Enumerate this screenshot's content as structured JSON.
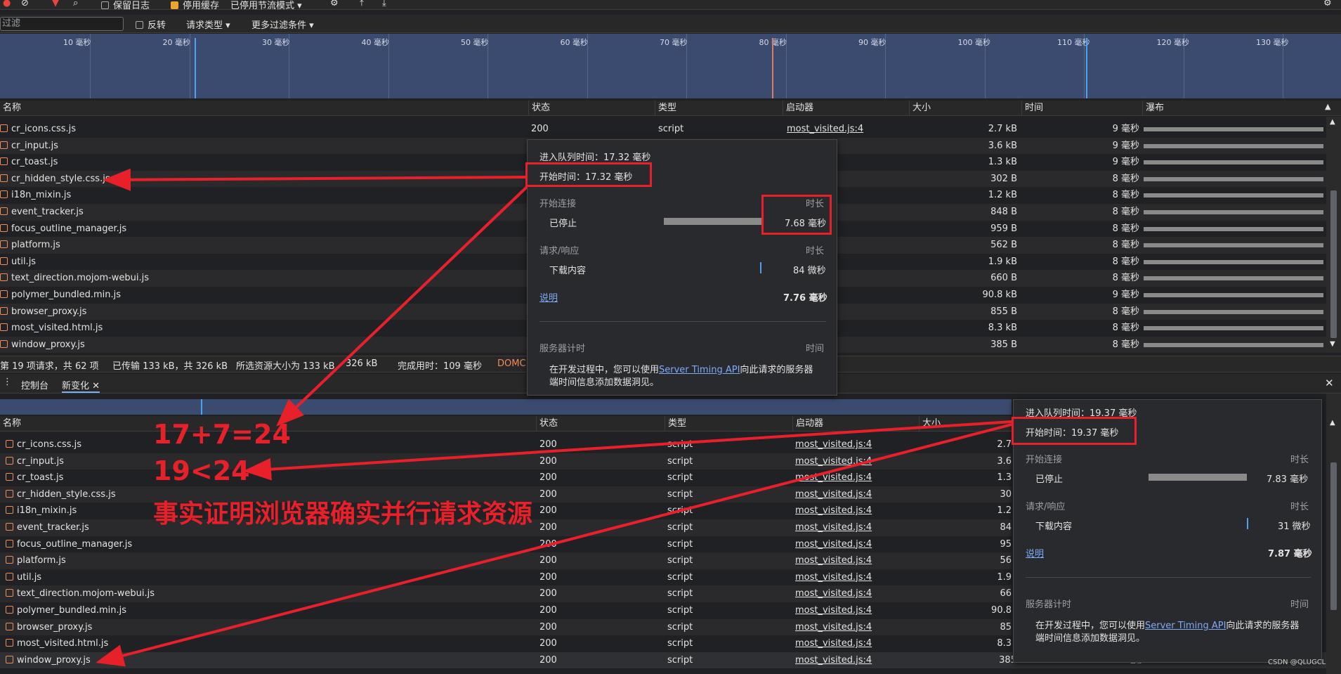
{
  "toolbar": {
    "preserve_log": "保留日志",
    "disable_cache": "停用缓存",
    "throttle": "已停用节流模式"
  },
  "filterbar": {
    "filter_placeholder": "过滤",
    "invert": "反转",
    "request_type": "请求类型",
    "more_filters": "更多过滤条件"
  },
  "overview": {
    "ticks": [
      "10 毫秒",
      "20 毫秒",
      "30 毫秒",
      "40 毫秒",
      "50 毫秒",
      "60 毫秒",
      "70 毫秒",
      "80 毫秒",
      "90 毫秒",
      "100 毫秒",
      "110 毫秒",
      "120 毫秒",
      "130 毫秒"
    ]
  },
  "columns": {
    "name": "名称",
    "status": "状态",
    "type": "类型",
    "initiator": "启动器",
    "size": "大小",
    "time": "时间",
    "waterfall": "瀑布"
  },
  "table_top": {
    "rows": [
      {
        "name": "cr_icons.css.js",
        "status": "200",
        "type": "script",
        "initiator": "most_visited.js:4",
        "size": "2.7 kB",
        "time": "9 毫秒"
      },
      {
        "name": "cr_input.js",
        "status": "",
        "type": "",
        "initiator": "js:4",
        "size": "3.6 kB",
        "time": "9 毫秒"
      },
      {
        "name": "cr_toast.js",
        "status": "",
        "type": "",
        "initiator": "js:4",
        "size": "1.3 kB",
        "time": "9 毫秒"
      },
      {
        "name": "cr_hidden_style.css.js",
        "status": "",
        "type": "",
        "initiator": "js:4",
        "size": "302 B",
        "time": "8 毫秒"
      },
      {
        "name": "i18n_mixin.js",
        "status": "",
        "type": "",
        "initiator": "js:4",
        "size": "1.2 kB",
        "time": "8 毫秒"
      },
      {
        "name": "event_tracker.js",
        "status": "",
        "type": "",
        "initiator": "js:4",
        "size": "848 B",
        "time": "8 毫秒"
      },
      {
        "name": "focus_outline_manager.js",
        "status": "",
        "type": "",
        "initiator": "js:4",
        "size": "959 B",
        "time": "8 毫秒"
      },
      {
        "name": "platform.js",
        "status": "",
        "type": "",
        "initiator": "js:4",
        "size": "562 B",
        "time": "8 毫秒"
      },
      {
        "name": "util.js",
        "status": "",
        "type": "",
        "initiator": "js:4",
        "size": "1.9 kB",
        "time": "8 毫秒"
      },
      {
        "name": "text_direction.mojom-webui.js",
        "status": "",
        "type": "",
        "initiator": "js:4",
        "size": "660 B",
        "time": "8 毫秒"
      },
      {
        "name": "polymer_bundled.min.js",
        "status": "",
        "type": "",
        "initiator": "js:4",
        "size": "90.8 kB",
        "time": "9 毫秒"
      },
      {
        "name": "browser_proxy.js",
        "status": "",
        "type": "",
        "initiator": "js:4",
        "size": "855 B",
        "time": "8 毫秒"
      },
      {
        "name": "most_visited.html.js",
        "status": "",
        "type": "",
        "initiator": "js:4",
        "size": "8.3 kB",
        "time": "8 毫秒"
      },
      {
        "name": "window_proxy.js",
        "status": "",
        "type": "",
        "initiator": "js:4",
        "size": "385 B",
        "time": "8 毫秒"
      }
    ]
  },
  "statusbar": {
    "requests": "第 19 项请求，共 62 项",
    "transferred": "已传输 133 kB，共 326 kB",
    "selected": "所选资源大小为 133 kB",
    "resources": "326 kB",
    "finish": "完成用时：109 毫秒",
    "domcontent": "DOMC"
  },
  "drawer": {
    "console_tab": "控制台",
    "whats_new_tab": "新变化"
  },
  "table_bottom": {
    "rows": [
      {
        "name": "cr_icons.css.js",
        "status": "200",
        "type": "script",
        "initiator": "most_visited.js:4",
        "size": "2.7"
      },
      {
        "name": "cr_input.js",
        "status": "200",
        "type": "script",
        "initiator": "most_visited.js:4",
        "size": "3.6"
      },
      {
        "name": "cr_toast.js",
        "status": "200",
        "type": "script",
        "initiator": "most_visited.js:4",
        "size": "1.3"
      },
      {
        "name": "cr_hidden_style.css.js",
        "status": "200",
        "type": "script",
        "initiator": "most_visited.js:4",
        "size": "30"
      },
      {
        "name": "i18n_mixin.js",
        "status": "200",
        "type": "script",
        "initiator": "most_visited.js:4",
        "size": "1.2"
      },
      {
        "name": "event_tracker.js",
        "status": "200",
        "type": "script",
        "initiator": "most_visited.js:4",
        "size": "84"
      },
      {
        "name": "focus_outline_manager.js",
        "status": "200",
        "type": "script",
        "initiator": "most_visited.js:4",
        "size": "95"
      },
      {
        "name": "platform.js",
        "status": "200",
        "type": "script",
        "initiator": "most_visited.js:4",
        "size": "56"
      },
      {
        "name": "util.js",
        "status": "200",
        "type": "script",
        "initiator": "most_visited.js:4",
        "size": "1.9"
      },
      {
        "name": "text_direction.mojom-webui.js",
        "status": "200",
        "type": "script",
        "initiator": "most_visited.js:4",
        "size": "66"
      },
      {
        "name": "polymer_bundled.min.js",
        "status": "200",
        "type": "script",
        "initiator": "most_visited.js:4",
        "size": "90.8"
      },
      {
        "name": "browser_proxy.js",
        "status": "200",
        "type": "script",
        "initiator": "most_visited.js:4",
        "size": "85"
      },
      {
        "name": "most_visited.html.js",
        "status": "200",
        "type": "script",
        "initiator": "most_visited.js:4",
        "size": "8.3"
      },
      {
        "name": "window_proxy.js",
        "status": "200",
        "type": "script",
        "initiator": "most_visited.js:4",
        "size": "385 B",
        "time": "8 毫秒"
      }
    ]
  },
  "popup_top": {
    "queued": "进入队列时间：17.32 毫秒",
    "started": "开始时间：17.32 毫秒",
    "conn_start": "开始连接",
    "duration_label": "时长",
    "stalled": "已停止",
    "stalled_value": "7.68 毫秒",
    "req_resp": "请求/响应",
    "download": "下载内容",
    "download_value": "84 微秒",
    "explain": "说明",
    "total": "7.76 毫秒",
    "server_timing": "服务器计时",
    "time_label": "时间",
    "note_prefix": "在开发过程中，您可以使用",
    "note_link": "Server Timing API",
    "note_suffix": "向此请求的服务器",
    "note_line2": "端时间信息添加数据洞见。"
  },
  "popup_bottom": {
    "queued": "进入队列时间：19.37 毫秒",
    "started": "开始时间：19.37 毫秒",
    "conn_start": "开始连接",
    "duration_label": "时长",
    "stalled": "已停止",
    "stalled_value": "7.83 毫秒",
    "req_resp": "请求/响应",
    "download": "下载内容",
    "download_value": "31 微秒",
    "explain": "说明",
    "total": "7.87 毫秒",
    "server_timing": "服务器计时",
    "time_label": "时间",
    "note_prefix": "在开发过程中，您可以使用",
    "note_link": "Server Timing API",
    "note_suffix": "向此请求的服务器",
    "note_line2": "端时间信息添加数据洞见。"
  },
  "annotations": {
    "line1": "17+7=24",
    "line2": "19<24",
    "line3": "事实证明浏览器确实并行请求资源"
  },
  "watermark": "CSDN @QLUGCL",
  "colors": {
    "annotation_red": "#e8202a",
    "overview_blue": "#3b4b6f",
    "checkbox_orange": "#f0a430"
  }
}
